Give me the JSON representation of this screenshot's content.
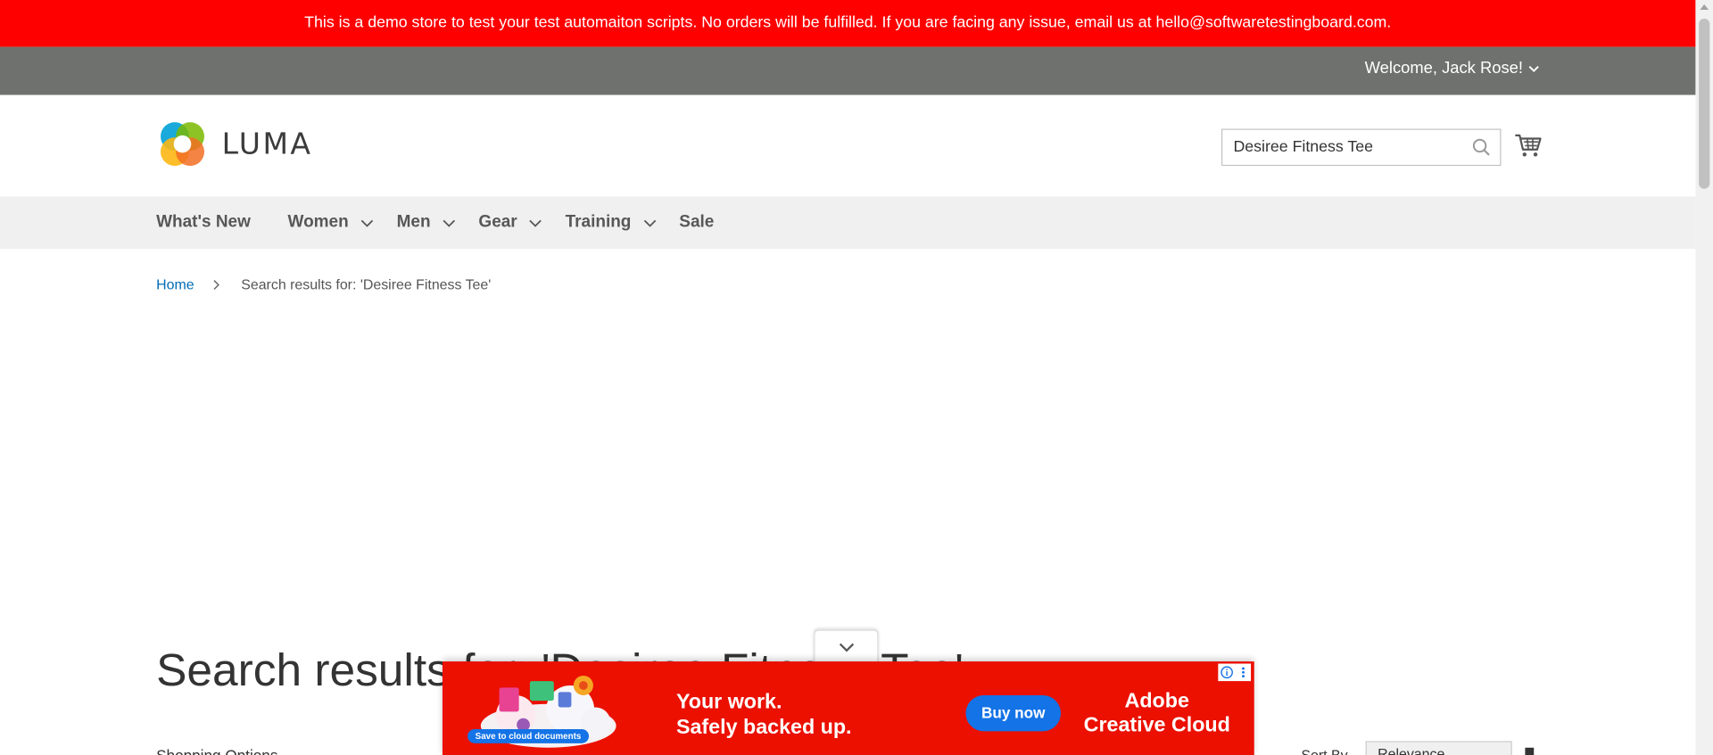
{
  "demo_banner": "This is a demo store to test your test automaiton scripts. No orders will be fulfilled. If you are facing any issue, email us at hello@softwaretestingboard.com.",
  "header": {
    "welcome": "Welcome, Jack Rose!",
    "logo_text": "LUMA",
    "search_value": "Desiree Fitness Tee",
    "brand_colors": [
      "#f26f23",
      "#7ab800",
      "#00a0d6",
      "#fcb713"
    ]
  },
  "nav": {
    "items": [
      {
        "label": "What's New"
      },
      {
        "label": "Women"
      },
      {
        "label": "Men"
      },
      {
        "label": "Gear"
      },
      {
        "label": "Training"
      },
      {
        "label": "Sale"
      }
    ]
  },
  "breadcrumbs": {
    "home": "Home",
    "current": "Search results for: 'Desiree Fitness Tee'"
  },
  "page": {
    "title": "Search results for: 'Desiree Fitness Tee'",
    "shop_by": "Shopping Options",
    "sort_label": "Sort By",
    "sort_value": "Relevance"
  },
  "ad": {
    "save_badge": "Save to cloud documents",
    "headline_1": "Your work.",
    "headline_2": "Safely backed up.",
    "button": "Buy now",
    "brand_1": "Adobe",
    "brand_2": "Creative Cloud",
    "background": "#eb1000"
  },
  "colors": {
    "banner": "#ff0000",
    "panel_header": "#6e716e",
    "nav_bg": "#f0f0f0",
    "link": "#006bb4"
  }
}
